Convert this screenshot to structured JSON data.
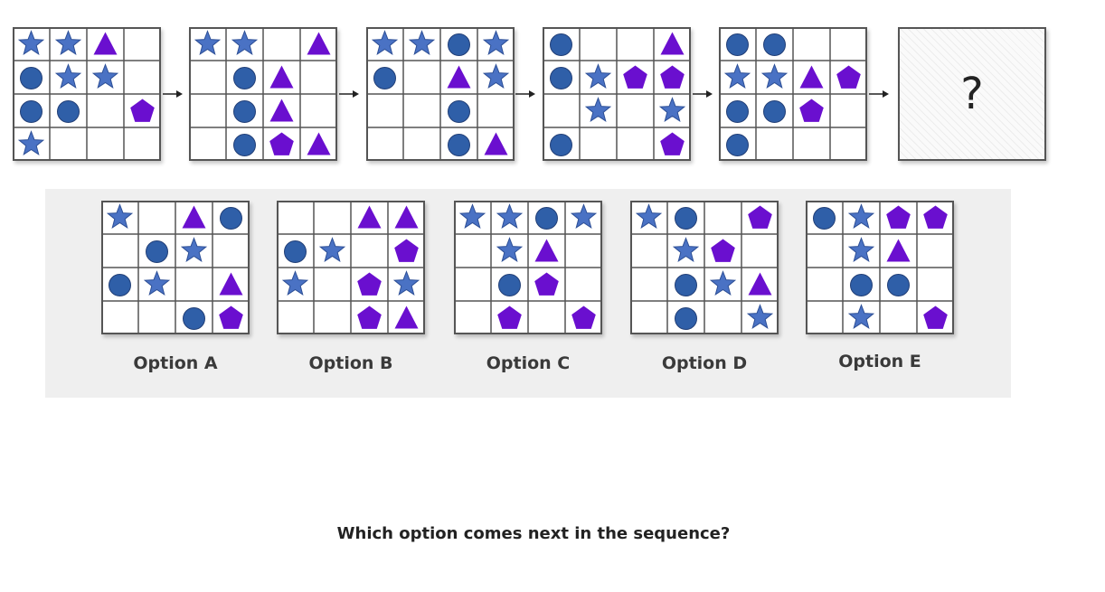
{
  "colors": {
    "star": "#4a72c4",
    "star_stroke": "#2d4f96",
    "circle": "#2f5fa8",
    "circle_stroke": "#223f77",
    "triangle": "#6a0fcf",
    "pentagon": "#6a0fcf",
    "grid_line": "#555555"
  },
  "sequence": [
    [
      [
        "star",
        "star",
        "triangle",
        ""
      ],
      [
        "circle",
        "star",
        "star",
        ""
      ],
      [
        "circle",
        "circle",
        "",
        "pentagon"
      ],
      [
        "star",
        "",
        "",
        ""
      ]
    ],
    [
      [
        "star",
        "star",
        "",
        "triangle"
      ],
      [
        "",
        "circle",
        "triangle",
        ""
      ],
      [
        "",
        "circle",
        "triangle",
        ""
      ],
      [
        "",
        "circle",
        "pentagon",
        "triangle"
      ]
    ],
    [
      [
        "star",
        "star",
        "circle",
        "star"
      ],
      [
        "circle",
        "",
        "triangle",
        "star"
      ],
      [
        "",
        "",
        "circle",
        ""
      ],
      [
        "",
        "",
        "circle",
        "triangle"
      ]
    ],
    [
      [
        "circle",
        "",
        "",
        "triangle"
      ],
      [
        "circle",
        "star",
        "pentagon",
        "pentagon"
      ],
      [
        "",
        "star",
        "",
        "star"
      ],
      [
        "circle",
        "",
        "",
        "pentagon"
      ]
    ],
    [
      [
        "circle",
        "circle",
        "",
        ""
      ],
      [
        "star",
        "star",
        "triangle",
        "pentagon"
      ],
      [
        "circle",
        "circle",
        "pentagon",
        ""
      ],
      [
        "circle",
        "",
        "",
        ""
      ]
    ]
  ],
  "unknown_mark": "?",
  "options": [
    {
      "label": "Option A",
      "grid": [
        [
          "star",
          "",
          "triangle",
          "circle"
        ],
        [
          "",
          "circle",
          "star",
          ""
        ],
        [
          "circle",
          "star",
          "",
          "triangle"
        ],
        [
          "",
          "",
          "circle",
          "pentagon"
        ]
      ]
    },
    {
      "label": "Option B",
      "grid": [
        [
          "",
          "",
          "triangle",
          "triangle"
        ],
        [
          "circle",
          "star",
          "",
          "pentagon"
        ],
        [
          "star",
          "",
          "pentagon",
          "star"
        ],
        [
          "",
          "",
          "pentagon",
          "triangle"
        ]
      ]
    },
    {
      "label": "Option C",
      "grid": [
        [
          "star",
          "star",
          "circle",
          "star"
        ],
        [
          "",
          "star",
          "triangle",
          ""
        ],
        [
          "",
          "circle",
          "pentagon",
          ""
        ],
        [
          "",
          "pentagon",
          "",
          "pentagon"
        ]
      ]
    },
    {
      "label": "Option D",
      "grid": [
        [
          "star",
          "circle",
          "",
          "pentagon"
        ],
        [
          "",
          "star",
          "pentagon",
          ""
        ],
        [
          "",
          "circle",
          "star",
          "triangle"
        ],
        [
          "",
          "circle",
          "",
          "star"
        ]
      ]
    },
    {
      "label": "Option E",
      "grid": [
        [
          "circle",
          "star",
          "pentagon",
          "pentagon"
        ],
        [
          "",
          "star",
          "triangle",
          ""
        ],
        [
          "",
          "circle",
          "circle",
          ""
        ],
        [
          "",
          "star",
          "",
          "pentagon"
        ]
      ]
    }
  ],
  "question": "Which option comes next in the sequence?"
}
